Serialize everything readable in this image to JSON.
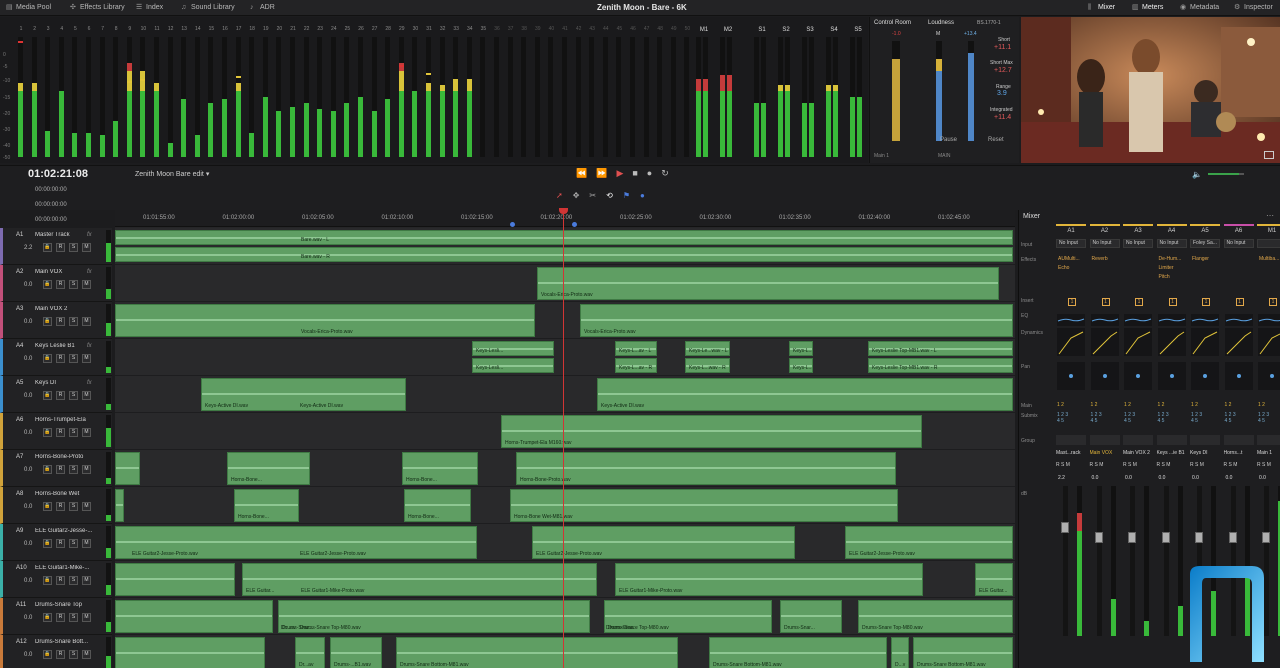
{
  "toolbar": {
    "media_pool": "Media Pool",
    "effects_library": "Effects Library",
    "index": "Index",
    "sound_library": "Sound Library",
    "adr": "ADR",
    "project_title": "Zenith Moon - Bare - 6K",
    "mixer": "Mixer",
    "meters": "Meters",
    "metadata": "Metadata",
    "inspector": "Inspector"
  },
  "meters": {
    "scale": [
      "0",
      "-5",
      "-10",
      "-15",
      "-20",
      "-30",
      "-40",
      "-50"
    ],
    "channels": [
      "1",
      "2",
      "3",
      "4",
      "5",
      "6",
      "7",
      "8",
      "9",
      "10",
      "11",
      "12",
      "13",
      "14",
      "15",
      "16",
      "17",
      "18",
      "19",
      "20",
      "21",
      "22",
      "23",
      "24",
      "25",
      "26",
      "27",
      "28",
      "29",
      "30",
      "31",
      "32",
      "33",
      "34",
      "35",
      "36",
      "37",
      "38",
      "39",
      "40",
      "41",
      "42",
      "43",
      "44",
      "45",
      "46",
      "47",
      "48",
      "49",
      "50"
    ],
    "bus_labels": [
      "M1",
      "M2",
      "S1",
      "S2",
      "S3",
      "S4",
      "S5"
    ]
  },
  "control_room": {
    "title": "Control Room",
    "val": "-1.0",
    "bottom_left": "Main 1",
    "bottom_right": "MAIN"
  },
  "loudness": {
    "title": "Loudness",
    "standard": "BS.1770-1",
    "m_label": "M",
    "m_val": "+13.4",
    "short_label": "Short",
    "short_val": "+11.1",
    "short_max_label": "Short Max",
    "short_max_val": "+12.7",
    "range_label": "Range",
    "range_val": "3.9",
    "integrated_label": "Integrated",
    "integrated_val": "+11.4",
    "pause": "Pause",
    "reset": "Reset"
  },
  "transport": {
    "timecode": "01:02:21:08",
    "sub1": "00:00:00:00",
    "sub2": "00:00:00:00",
    "sub3": "00:00:00:00",
    "timeline_name": "Zenith Moon Bare edit"
  },
  "ruler": [
    "01:01:55:00",
    "01:02:00:00",
    "01:02:05:00",
    "01:02:10:00",
    "01:02:15:00",
    "01:02:20:00",
    "01:02:25:00",
    "01:02:30:00",
    "01:02:35:00",
    "01:02:40:00",
    "01:02:45:00"
  ],
  "tracks": [
    {
      "id": "A1",
      "name": "Master Track",
      "vol": "2.2",
      "fx": "fx"
    },
    {
      "id": "A2",
      "name": "Main VOX",
      "vol": "0.0",
      "fx": "fx"
    },
    {
      "id": "A3",
      "name": "Main VOX 2",
      "vol": "0.0",
      "fx": ""
    },
    {
      "id": "A4",
      "name": "Keys Leslie B1",
      "vol": "0.0",
      "fx": "fx"
    },
    {
      "id": "A5",
      "name": "Keys DI",
      "vol": "0.0",
      "fx": "fx"
    },
    {
      "id": "A6",
      "name": "Horns-Trumpet-Ela",
      "vol": "0.0",
      "fx": ""
    },
    {
      "id": "A7",
      "name": "Horns-Bone-Proto",
      "vol": "0.0",
      "fx": ""
    },
    {
      "id": "A8",
      "name": "Horns-Bone Wet",
      "vol": "0.0",
      "fx": ""
    },
    {
      "id": "A9",
      "name": "ELE Guitar2-Jesse-...",
      "vol": "0.0",
      "fx": ""
    },
    {
      "id": "A10",
      "name": "ELE Guitar1-Mike-...",
      "vol": "0.0",
      "fx": ""
    },
    {
      "id": "A11",
      "name": "Drums-Snare Top",
      "vol": "0.0",
      "fx": ""
    },
    {
      "id": "A12",
      "name": "Drums-Snare Bott...",
      "vol": "0.0",
      "fx": ""
    }
  ],
  "btn": {
    "r": "R",
    "s": "S",
    "m": "M"
  },
  "clips": {
    "a1a": "Bare.wav - L",
    "a1b": "Bare.wav - R",
    "a2": "Vocals-Erica-Proto.wav",
    "a3a": "Vocals-Erica-Proto.wav",
    "a3b": "Vocals-Erica-Proto.wav",
    "a4a": "Keys-Lesli...",
    "a4b": "Keys-L...av - L",
    "a4c": "Keys-Le...wav - L",
    "a4d": "Keys-L...",
    "a4e": "Keys-Leslie Top-MB1.wav - L",
    "a4f": "Keys-Lesli...",
    "a4g": "Keys-L...av - R",
    "a4h": "Keys-L...wav - R",
    "a4i": "Keys-L...",
    "a4j": "Keys-Leslie Top-MB1.wav - R",
    "a5a": "Keys-Active DI.wav",
    "a5b": "Keys-Active DI.wav",
    "a5c": "Keys-Active DI.wav",
    "a6": "Horns-Trumpet-Ela M160.wav",
    "a7a": "Horns-Bone...",
    "a7b": "Horns-Bone...",
    "a7c": "Horns-Bone-Proto.wav",
    "a8a": "Horns-Bone...",
    "a8b": "Horns-Bone...",
    "a8c": "Horns-Bone Wet-M81.wav",
    "a9a": "ELE Guitar2-Jesse-Proto.wav",
    "a9b": "ELE Guitar2-Jesse-Proto.wav",
    "a9c": "ELE Guitar2-Jesse-Proto.wav",
    "a9d": "ELE Guitar2-Jesse-Proto.wav",
    "a10a": "ELE Guitar...",
    "a10b": "ELE Guitar1-Mike-Proto.wav",
    "a10c": "ELE Guitar1-Mike-Proto.wav",
    "a10d": "ELE Guitar...",
    "a11a": "Dr...av",
    "a11b": "Drums-Snar...",
    "a11c": "Drums-Snare Top-M80.wav",
    "a11d": "Drums-Snar...",
    "a11e": "Drums-Snare Top-M80.wav",
    "a11f": "Drums-Snar...",
    "a11g": "Drums-Snare Top-M80.wav",
    "a12a": "Dr...av",
    "a12b": "Drums-...B1.wav",
    "a12c": "Drums-Snare Bottom-M81.wav",
    "a12d": "Drums-Snare Bottom-M81.wav",
    "a12e": "D...v",
    "a12f": "Drums-Snare Bottom-M81.wav"
  },
  "mixer": {
    "title": "Mixer",
    "rows": {
      "input": "Input",
      "effects": "Effects",
      "insert": "Insert",
      "eq": "EQ",
      "dynamics": "Dynamics",
      "pan": "Pan",
      "main": "Main",
      "submix": "Submix",
      "group": "Group",
      "db": "dB"
    },
    "strips": [
      {
        "id": "A1",
        "input": "No Input",
        "fx": [
          "AUMulti...",
          "Echo"
        ],
        "name": "Mast...rack",
        "vol": "2.2"
      },
      {
        "id": "A2",
        "input": "No Input",
        "fx": [
          "Reverb"
        ],
        "name": "Main VOX",
        "vol": "0.0"
      },
      {
        "id": "A3",
        "input": "No Input",
        "fx": [],
        "name": "Main VOX 2",
        "vol": "0.0"
      },
      {
        "id": "A4",
        "input": "No Input",
        "fx": [
          "De-Hum...",
          "Limiter",
          "Pitch"
        ],
        "name": "Keys ...ie B1",
        "vol": "0.0"
      },
      {
        "id": "A5",
        "input": "Foley Sa...",
        "fx": [
          "Flanger"
        ],
        "name": "Keys DI",
        "vol": "0.0"
      },
      {
        "id": "A6",
        "input": "No Input",
        "fx": [],
        "name": "Horns...t",
        "vol": "0.0"
      },
      {
        "id": "M1",
        "input": "",
        "fx": [
          "Multiba..."
        ],
        "name": "Main 1",
        "vol": "0.0"
      }
    ]
  }
}
